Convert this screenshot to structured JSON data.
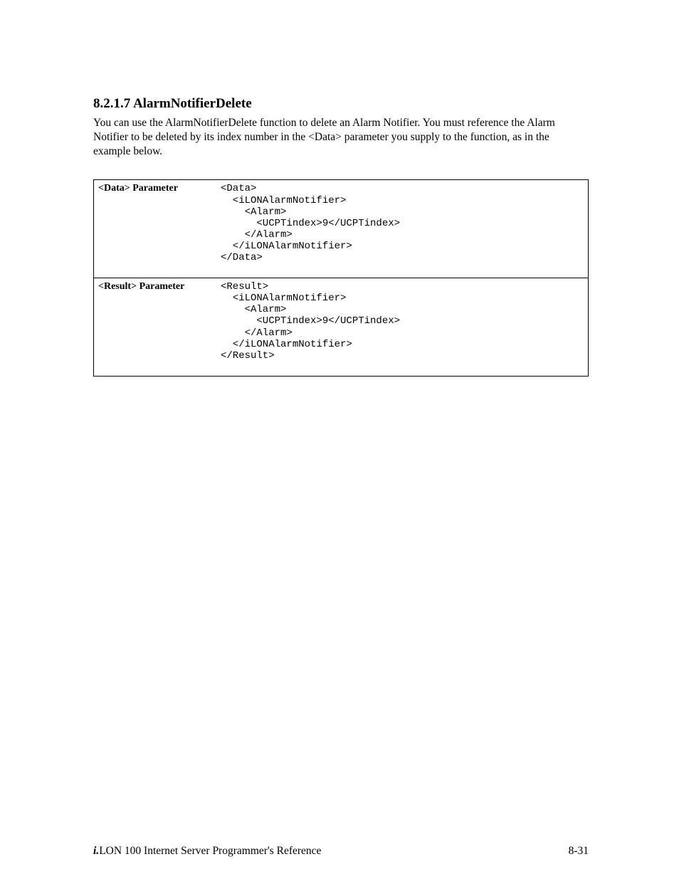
{
  "heading": "8.2.1.7 AlarmNotifierDelete",
  "intro": "You can use the AlarmNotifierDelete function to delete an Alarm Notifier. You must reference the Alarm Notifier to be deleted by its index number in the <Data> parameter you supply to the function, as in the example below.",
  "rows": [
    {
      "label": "<Data> Parameter",
      "code": "<Data>\n  <iLONAlarmNotifier>\n    <Alarm>\n      <UCPTindex>9</UCPTindex>\n    </Alarm>\n  </iLONAlarmNotifier>\n</Data>"
    },
    {
      "label": "<Result> Parameter",
      "code": "<Result>\n  <iLONAlarmNotifier>\n    <Alarm>\n      <UCPTindex>9</UCPTindex>\n    </Alarm>\n  </iLONAlarmNotifier>\n</Result>"
    }
  ],
  "footer": {
    "prefix": "i.",
    "title": "LON 100 Internet Server Programmer's Reference",
    "page": "8-31"
  }
}
